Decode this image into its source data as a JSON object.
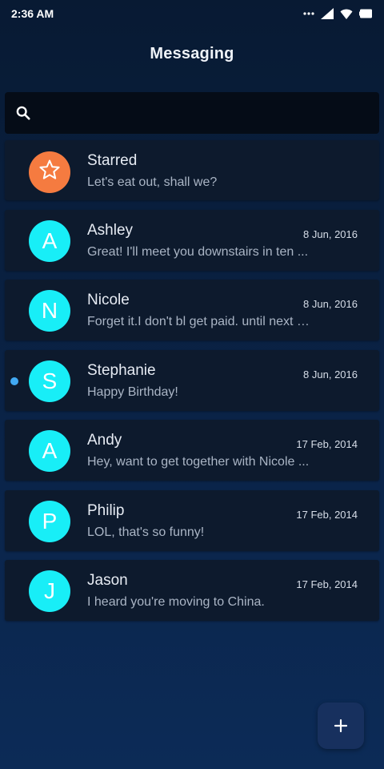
{
  "status_bar": {
    "time": "2:36 AM",
    "icons": [
      "more-dots-icon",
      "signal-icon",
      "wifi-icon",
      "battery-icon"
    ]
  },
  "header": {
    "title": "Messaging"
  },
  "search": {
    "icon": "search-icon",
    "value": "",
    "placeholder": ""
  },
  "conversations": [
    {
      "name": "Starred",
      "initial": "",
      "icon": "star-icon",
      "date": "",
      "snippet": "Let's eat out, shall we?",
      "unread": false
    },
    {
      "name": "Ashley",
      "initial": "A",
      "date": "8 Jun, 2016",
      "snippet": "Great! I'll meet you downstairs in ten ...",
      "unread": false
    },
    {
      "name": "Nicole",
      "initial": "N",
      "date": "8 Jun, 2016",
      "snippet": "Forget it.I don't bl get paid. until next F...",
      "unread": false
    },
    {
      "name": "Stephanie",
      "initial": "S",
      "date": "8 Jun, 2016",
      "snippet": "Happy Birthday!",
      "unread": true
    },
    {
      "name": "Andy",
      "initial": "A",
      "date": "17 Feb, 2014",
      "snippet": "Hey, want to get together with Nicole ...",
      "unread": false
    },
    {
      "name": "Philip",
      "initial": "P",
      "date": "17 Feb, 2014",
      "snippet": "LOL, that's so funny!",
      "unread": false
    },
    {
      "name": "Jason",
      "initial": "J",
      "date": "17 Feb, 2014",
      "snippet": "I heard you're moving to China.",
      "unread": false
    }
  ],
  "fab": {
    "icon": "plus-icon"
  },
  "colors": {
    "avatar": "#18eef7",
    "starred_avatar": "#f57b40",
    "unread_dot": "#41a9f3",
    "card": "#0d1a2d",
    "search_bg": "#050c17",
    "fab": "#17305e"
  }
}
